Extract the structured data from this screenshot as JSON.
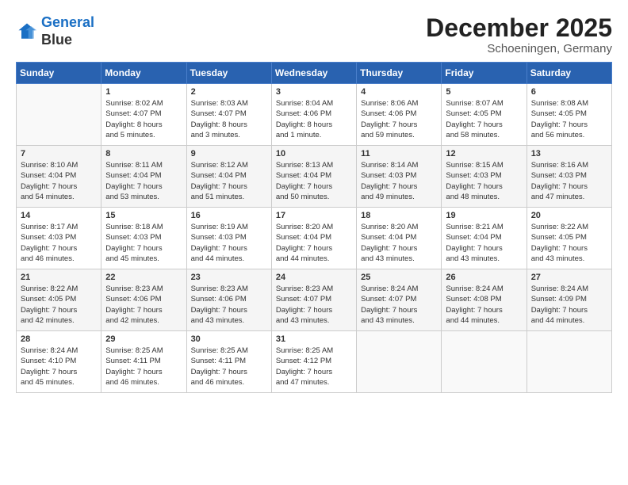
{
  "logo": {
    "line1": "General",
    "line2": "Blue"
  },
  "title": "December 2025",
  "location": "Schoeningen, Germany",
  "days_of_week": [
    "Sunday",
    "Monday",
    "Tuesday",
    "Wednesday",
    "Thursday",
    "Friday",
    "Saturday"
  ],
  "weeks": [
    [
      {
        "day": "",
        "info": ""
      },
      {
        "day": "1",
        "info": "Sunrise: 8:02 AM\nSunset: 4:07 PM\nDaylight: 8 hours\nand 5 minutes."
      },
      {
        "day": "2",
        "info": "Sunrise: 8:03 AM\nSunset: 4:07 PM\nDaylight: 8 hours\nand 3 minutes."
      },
      {
        "day": "3",
        "info": "Sunrise: 8:04 AM\nSunset: 4:06 PM\nDaylight: 8 hours\nand 1 minute."
      },
      {
        "day": "4",
        "info": "Sunrise: 8:06 AM\nSunset: 4:06 PM\nDaylight: 7 hours\nand 59 minutes."
      },
      {
        "day": "5",
        "info": "Sunrise: 8:07 AM\nSunset: 4:05 PM\nDaylight: 7 hours\nand 58 minutes."
      },
      {
        "day": "6",
        "info": "Sunrise: 8:08 AM\nSunset: 4:05 PM\nDaylight: 7 hours\nand 56 minutes."
      }
    ],
    [
      {
        "day": "7",
        "info": "Sunrise: 8:10 AM\nSunset: 4:04 PM\nDaylight: 7 hours\nand 54 minutes."
      },
      {
        "day": "8",
        "info": "Sunrise: 8:11 AM\nSunset: 4:04 PM\nDaylight: 7 hours\nand 53 minutes."
      },
      {
        "day": "9",
        "info": "Sunrise: 8:12 AM\nSunset: 4:04 PM\nDaylight: 7 hours\nand 51 minutes."
      },
      {
        "day": "10",
        "info": "Sunrise: 8:13 AM\nSunset: 4:04 PM\nDaylight: 7 hours\nand 50 minutes."
      },
      {
        "day": "11",
        "info": "Sunrise: 8:14 AM\nSunset: 4:03 PM\nDaylight: 7 hours\nand 49 minutes."
      },
      {
        "day": "12",
        "info": "Sunrise: 8:15 AM\nSunset: 4:03 PM\nDaylight: 7 hours\nand 48 minutes."
      },
      {
        "day": "13",
        "info": "Sunrise: 8:16 AM\nSunset: 4:03 PM\nDaylight: 7 hours\nand 47 minutes."
      }
    ],
    [
      {
        "day": "14",
        "info": "Sunrise: 8:17 AM\nSunset: 4:03 PM\nDaylight: 7 hours\nand 46 minutes."
      },
      {
        "day": "15",
        "info": "Sunrise: 8:18 AM\nSunset: 4:03 PM\nDaylight: 7 hours\nand 45 minutes."
      },
      {
        "day": "16",
        "info": "Sunrise: 8:19 AM\nSunset: 4:03 PM\nDaylight: 7 hours\nand 44 minutes."
      },
      {
        "day": "17",
        "info": "Sunrise: 8:20 AM\nSunset: 4:04 PM\nDaylight: 7 hours\nand 44 minutes."
      },
      {
        "day": "18",
        "info": "Sunrise: 8:20 AM\nSunset: 4:04 PM\nDaylight: 7 hours\nand 43 minutes."
      },
      {
        "day": "19",
        "info": "Sunrise: 8:21 AM\nSunset: 4:04 PM\nDaylight: 7 hours\nand 43 minutes."
      },
      {
        "day": "20",
        "info": "Sunrise: 8:22 AM\nSunset: 4:05 PM\nDaylight: 7 hours\nand 43 minutes."
      }
    ],
    [
      {
        "day": "21",
        "info": "Sunrise: 8:22 AM\nSunset: 4:05 PM\nDaylight: 7 hours\nand 42 minutes."
      },
      {
        "day": "22",
        "info": "Sunrise: 8:23 AM\nSunset: 4:06 PM\nDaylight: 7 hours\nand 42 minutes."
      },
      {
        "day": "23",
        "info": "Sunrise: 8:23 AM\nSunset: 4:06 PM\nDaylight: 7 hours\nand 43 minutes."
      },
      {
        "day": "24",
        "info": "Sunrise: 8:23 AM\nSunset: 4:07 PM\nDaylight: 7 hours\nand 43 minutes."
      },
      {
        "day": "25",
        "info": "Sunrise: 8:24 AM\nSunset: 4:07 PM\nDaylight: 7 hours\nand 43 minutes."
      },
      {
        "day": "26",
        "info": "Sunrise: 8:24 AM\nSunset: 4:08 PM\nDaylight: 7 hours\nand 44 minutes."
      },
      {
        "day": "27",
        "info": "Sunrise: 8:24 AM\nSunset: 4:09 PM\nDaylight: 7 hours\nand 44 minutes."
      }
    ],
    [
      {
        "day": "28",
        "info": "Sunrise: 8:24 AM\nSunset: 4:10 PM\nDaylight: 7 hours\nand 45 minutes."
      },
      {
        "day": "29",
        "info": "Sunrise: 8:25 AM\nSunset: 4:11 PM\nDaylight: 7 hours\nand 46 minutes."
      },
      {
        "day": "30",
        "info": "Sunrise: 8:25 AM\nSunset: 4:11 PM\nDaylight: 7 hours\nand 46 minutes."
      },
      {
        "day": "31",
        "info": "Sunrise: 8:25 AM\nSunset: 4:12 PM\nDaylight: 7 hours\nand 47 minutes."
      },
      {
        "day": "",
        "info": ""
      },
      {
        "day": "",
        "info": ""
      },
      {
        "day": "",
        "info": ""
      }
    ]
  ]
}
